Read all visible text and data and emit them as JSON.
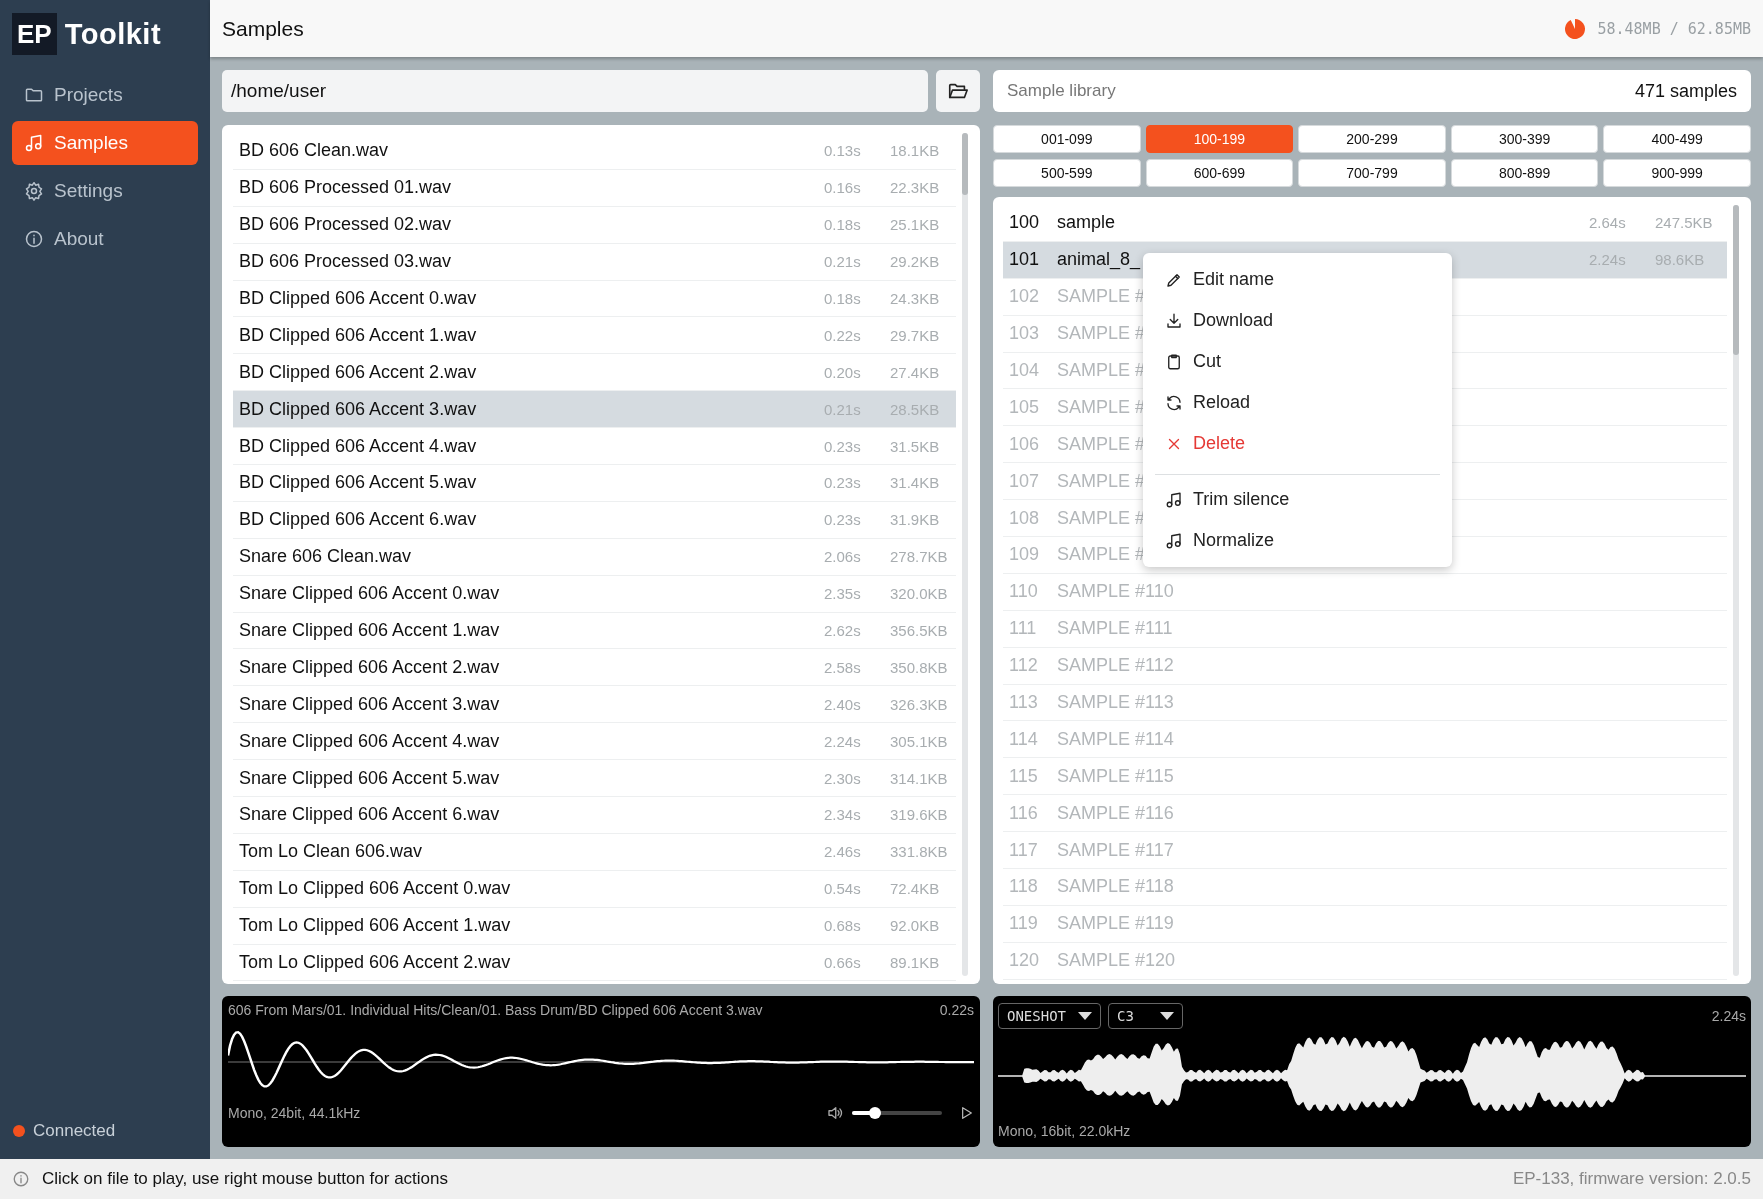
{
  "app": {
    "logo_badge": "EP",
    "logo_text": "Toolkit"
  },
  "sidebar": {
    "items": [
      {
        "label": "Projects",
        "selected": false
      },
      {
        "label": "Samples",
        "selected": true
      },
      {
        "label": "Settings",
        "selected": false
      },
      {
        "label": "About",
        "selected": false
      }
    ],
    "connection": {
      "label": "Connected",
      "connected": true
    }
  },
  "header": {
    "title": "Samples",
    "memory": {
      "text": "58.48MB / 62.85MB",
      "level": 0.93
    }
  },
  "files": {
    "path": "/home/user",
    "rows": [
      {
        "name": "BD 606 Clean.wav",
        "duration": "0.13s",
        "size": "18.1KB",
        "selected": false
      },
      {
        "name": "BD 606 Processed 01.wav",
        "duration": "0.16s",
        "size": "22.3KB",
        "selected": false
      },
      {
        "name": "BD 606 Processed 02.wav",
        "duration": "0.18s",
        "size": "25.1KB",
        "selected": false
      },
      {
        "name": "BD 606 Processed 03.wav",
        "duration": "0.21s",
        "size": "29.2KB",
        "selected": false
      },
      {
        "name": "BD Clipped 606 Accent 0.wav",
        "duration": "0.18s",
        "size": "24.3KB",
        "selected": false
      },
      {
        "name": "BD Clipped 606 Accent 1.wav",
        "duration": "0.22s",
        "size": "29.7KB",
        "selected": false
      },
      {
        "name": "BD Clipped 606 Accent 2.wav",
        "duration": "0.20s",
        "size": "27.4KB",
        "selected": false
      },
      {
        "name": "BD Clipped 606 Accent 3.wav",
        "duration": "0.21s",
        "size": "28.5KB",
        "selected": true
      },
      {
        "name": "BD Clipped 606 Accent 4.wav",
        "duration": "0.23s",
        "size": "31.5KB",
        "selected": false
      },
      {
        "name": "BD Clipped 606 Accent 5.wav",
        "duration": "0.23s",
        "size": "31.4KB",
        "selected": false
      },
      {
        "name": "BD Clipped 606 Accent 6.wav",
        "duration": "0.23s",
        "size": "31.9KB",
        "selected": false
      },
      {
        "name": "Snare 606 Clean.wav",
        "duration": "2.06s",
        "size": "278.7KB",
        "selected": false
      },
      {
        "name": "Snare Clipped 606 Accent 0.wav",
        "duration": "2.35s",
        "size": "320.0KB",
        "selected": false
      },
      {
        "name": "Snare Clipped 606 Accent 1.wav",
        "duration": "2.62s",
        "size": "356.5KB",
        "selected": false
      },
      {
        "name": "Snare Clipped 606 Accent 2.wav",
        "duration": "2.58s",
        "size": "350.8KB",
        "selected": false
      },
      {
        "name": "Snare Clipped 606 Accent 3.wav",
        "duration": "2.40s",
        "size": "326.3KB",
        "selected": false
      },
      {
        "name": "Snare Clipped 606 Accent 4.wav",
        "duration": "2.24s",
        "size": "305.1KB",
        "selected": false
      },
      {
        "name": "Snare Clipped 606 Accent 5.wav",
        "duration": "2.30s",
        "size": "314.1KB",
        "selected": false
      },
      {
        "name": "Snare Clipped 606 Accent 6.wav",
        "duration": "2.34s",
        "size": "319.6KB",
        "selected": false
      },
      {
        "name": "Tom Lo Clean 606.wav",
        "duration": "2.46s",
        "size": "331.8KB",
        "selected": false
      },
      {
        "name": "Tom Lo Clipped 606 Accent 0.wav",
        "duration": "0.54s",
        "size": "72.4KB",
        "selected": false
      },
      {
        "name": "Tom Lo Clipped 606 Accent 1.wav",
        "duration": "0.68s",
        "size": "92.0KB",
        "selected": false
      },
      {
        "name": "Tom Lo Clipped 606 Accent 2.wav",
        "duration": "0.66s",
        "size": "89.1KB",
        "selected": false
      }
    ]
  },
  "library": {
    "title": "Sample library",
    "count": "471 samples",
    "ranges": [
      {
        "label": "001-099",
        "selected": false
      },
      {
        "label": "100-199",
        "selected": true
      },
      {
        "label": "200-299",
        "selected": false
      },
      {
        "label": "300-399",
        "selected": false
      },
      {
        "label": "400-499",
        "selected": false
      },
      {
        "label": "500-599",
        "selected": false
      },
      {
        "label": "600-699",
        "selected": false
      },
      {
        "label": "700-799",
        "selected": false
      },
      {
        "label": "800-899",
        "selected": false
      },
      {
        "label": "900-999",
        "selected": false
      }
    ],
    "rows": [
      {
        "kind": "sample",
        "number": "100",
        "name": "sample",
        "duration": "2.64s",
        "size": "247.5KB",
        "selected": false
      },
      {
        "kind": "sample",
        "number": "101",
        "name": "animal_8_",
        "duration": "2.24s",
        "size": "98.6KB",
        "selected": true
      },
      {
        "kind": "empty",
        "number": "102",
        "name": "SAMPLE #",
        "selected": false
      },
      {
        "kind": "empty",
        "number": "103",
        "name": "SAMPLE #",
        "selected": false
      },
      {
        "kind": "empty",
        "number": "104",
        "name": "SAMPLE #",
        "selected": false
      },
      {
        "kind": "empty",
        "number": "105",
        "name": "SAMPLE #",
        "selected": false
      },
      {
        "kind": "empty",
        "number": "106",
        "name": "SAMPLE #",
        "selected": false
      },
      {
        "kind": "empty",
        "number": "107",
        "name": "SAMPLE #",
        "selected": false
      },
      {
        "kind": "empty",
        "number": "108",
        "name": "SAMPLE #",
        "selected": false
      },
      {
        "kind": "empty",
        "number": "109",
        "name": "SAMPLE #",
        "selected": false
      },
      {
        "kind": "empty",
        "number": "110",
        "name": "SAMPLE #110",
        "selected": false
      },
      {
        "kind": "empty",
        "number": "111",
        "name": "SAMPLE #111",
        "selected": false
      },
      {
        "kind": "empty",
        "number": "112",
        "name": "SAMPLE #112",
        "selected": false
      },
      {
        "kind": "empty",
        "number": "113",
        "name": "SAMPLE #113",
        "selected": false
      },
      {
        "kind": "empty",
        "number": "114",
        "name": "SAMPLE #114",
        "selected": false
      },
      {
        "kind": "empty",
        "number": "115",
        "name": "SAMPLE #115",
        "selected": false
      },
      {
        "kind": "empty",
        "number": "116",
        "name": "SAMPLE #116",
        "selected": false
      },
      {
        "kind": "empty",
        "number": "117",
        "name": "SAMPLE #117",
        "selected": false
      },
      {
        "kind": "empty",
        "number": "118",
        "name": "SAMPLE #118",
        "selected": false
      },
      {
        "kind": "empty",
        "number": "119",
        "name": "SAMPLE #119",
        "selected": false
      },
      {
        "kind": "empty",
        "number": "120",
        "name": "SAMPLE #120",
        "selected": false
      }
    ],
    "context_menu": {
      "sections": [
        {
          "items": [
            {
              "label": "Edit name",
              "danger": false
            },
            {
              "label": "Download",
              "danger": false
            },
            {
              "label": "Cut",
              "danger": false
            },
            {
              "label": "Reload",
              "danger": false
            },
            {
              "label": "Delete",
              "danger": true
            }
          ]
        },
        {
          "items": [
            {
              "label": "Trim silence",
              "danger": false
            },
            {
              "label": "Normalize",
              "danger": false
            }
          ]
        }
      ]
    }
  },
  "file_player": {
    "path": "606 From Mars/01. Individual Hits/Clean/01. Bass Drum/BD Clipped 606 Accent 3.wav",
    "duration": "0.22s",
    "format": "Mono, 24bit, 44.1kHz",
    "volume": {
      "level": 0.25
    }
  },
  "library_player": {
    "mode": "ONESHOT",
    "note": "C3",
    "duration": "2.24s",
    "format": "Mono, 16bit, 22.0kHz"
  },
  "status_bar": {
    "hint": "Click on file to play, use right mouse button for actions",
    "firmware": "EP-133, firmware version: 2.0.5"
  }
}
